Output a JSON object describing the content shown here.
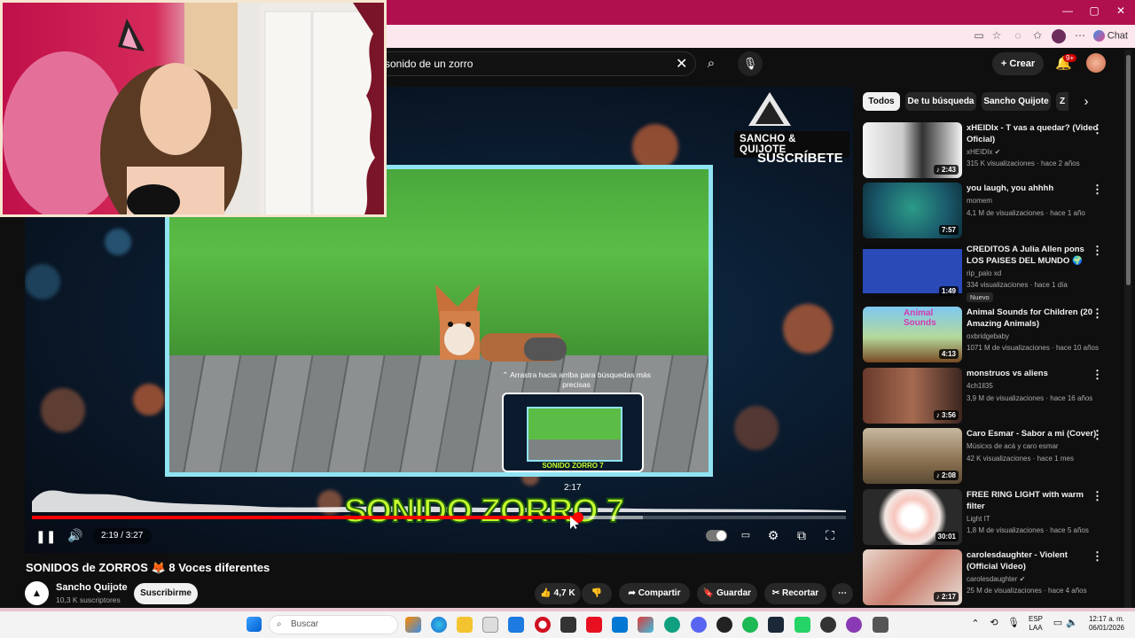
{
  "browser": {
    "chat_label": "Chat",
    "window_controls": [
      "—",
      "▢",
      "✕"
    ]
  },
  "header": {
    "search_value": "sonido de un zorro",
    "create_label": "Crear",
    "notifications_badge": "9+"
  },
  "player": {
    "overlay_channel": "SANCHO & QUIJOTE",
    "overlay_subscribe": "SUSCRÍBETE",
    "big_title": "SONIDO ZORRO 7",
    "time_display": "2:19 / 3:27",
    "progress_fraction": 0.671,
    "buffer_fraction": 0.75,
    "preview_time": "2:17",
    "preview_label": "SONIDO ZORRO 7",
    "preview_hint": "⌃ Arrastra hacia arriba para búsquedas más precisas"
  },
  "video": {
    "title": "SONIDOS de ZORROS 🦊 8 Voces diferentes",
    "channel": "Sancho Quijote",
    "subscribers": "10,3 K suscriptores",
    "subscribe_label": "Suscribirme",
    "likes": "4,7 K",
    "share_label": "Compartir",
    "save_label": "Guardar",
    "clip_label": "Recortar"
  },
  "chips": [
    "Todos",
    "De tu búsqueda",
    "Sancho Quijote",
    "Z"
  ],
  "recommendations": [
    {
      "title": "xHEIDIx - T vas a quedar? (Video Oficial)",
      "channel": "xHEIDIx",
      "meta": "315 K visualizaciones · hace 2 años",
      "duration": "2:43",
      "badge": ""
    },
    {
      "title": "you laugh, you ahhhh",
      "channel": "momem",
      "meta": "4,1 M de visualizaciones · hace 1 año",
      "duration": "7:57",
      "badge": ""
    },
    {
      "title": "CREDITOS A Julia Allen pons LOS PAISES DEL MUNDO 🌍",
      "channel": "rip_palo xd",
      "meta": "334 visualizaciones · hace 1 día",
      "duration": "1:49",
      "badge": "Nuevo"
    },
    {
      "title": "Animal Sounds for Children (20 Amazing Animals)",
      "channel": "oxbridgebaby",
      "meta": "1071 M de visualizaciones · hace 10 años",
      "duration": "4:13",
      "badge": "",
      "thumb_text": "Animal Sounds"
    },
    {
      "title": "monstruos vs aliens",
      "channel": "4ch1ll35",
      "meta": "3,9 M de visualizaciones · hace 16 años",
      "duration": "3:56",
      "badge": ""
    },
    {
      "title": "Caro Esmar - Sabor a mi (Cover)",
      "channel": "Músicxs de acá y caro esmar",
      "meta": "42 K visualizaciones · hace 1 mes",
      "duration": "2:08",
      "badge": ""
    },
    {
      "title": "FREE RING LIGHT with warm filter",
      "channel": "Light IT",
      "meta": "1,8 M de visualizaciones · hace 5 años",
      "duration": "30:01",
      "badge": ""
    },
    {
      "title": "carolesdaughter - Violent (Official Video)",
      "channel": "carolesdaughter",
      "meta": "25 M de visualizaciones · hace 4 años",
      "duration": "2:17",
      "badge": ""
    }
  ],
  "taskbar": {
    "search_placeholder": "Buscar",
    "language": "ESP",
    "language_sub": "LAA",
    "time": "12:17 a. m.",
    "date": "06/01/2026"
  },
  "colors": {
    "accent": "#ff0000",
    "browser_pink": "#b0104e",
    "title_green": "#c6ff2e"
  }
}
